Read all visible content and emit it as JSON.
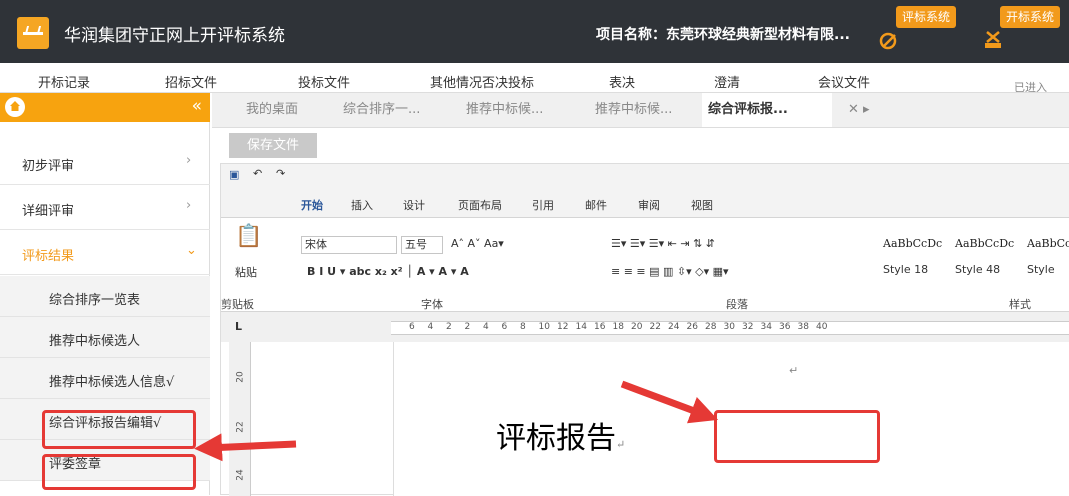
{
  "header": {
    "app_title": "华润集团守正网上开评标系统",
    "project_label": "项目名称：东莞环球经典新型材料有限...",
    "system_buttons": [
      "评标系统",
      "开标系统"
    ]
  },
  "menu": [
    "开标记录",
    "招标文件",
    "投标文件",
    "其他情况否决投标",
    "表决",
    "澄清",
    "会议文件",
    "已进入"
  ],
  "sidebar": {
    "collapse": "«",
    "items": [
      {
        "label": "初步评审",
        "chev": "›"
      },
      {
        "label": "详细评审",
        "chev": "›"
      },
      {
        "label": "评标结果",
        "chev": "⌄"
      }
    ],
    "subitems": [
      "综合排序一览表",
      "推荐中标候选人",
      "推荐中标候选人信息√",
      "综合评标报告编辑√",
      "评委签章"
    ]
  },
  "tabs": [
    "我的桌面",
    "综合排序一...",
    "推荐中标候...",
    "推荐中标候...",
    "综合评标报...",
    "✕ ▸"
  ],
  "save_button": "保存文件",
  "word": {
    "ribbon_tabs": [
      "开始",
      "插入",
      "设计",
      "页面布局",
      "引用",
      "邮件",
      "审阅",
      "视图"
    ],
    "font_name": "宋体",
    "font_size": "五号",
    "paste": "粘贴",
    "groups": [
      "剪贴板",
      "字体",
      "段落",
      "样式"
    ],
    "styles": [
      {
        "preview": "AaBbCcDc",
        "name": "Style 18"
      },
      {
        "preview": "AaBbCcDc",
        "name": "Style 48"
      },
      {
        "preview": "AaBbCc",
        "name": "Style"
      }
    ],
    "ruler_numbers": [
      "6",
      "4",
      "2",
      "2",
      "4",
      "6",
      "8",
      "10",
      "12",
      "14",
      "16",
      "18",
      "20",
      "22",
      "24",
      "26",
      "28",
      "30",
      "32",
      "34",
      "36",
      "38",
      "40"
    ],
    "vruler_numbers": [
      "20",
      "22",
      "24"
    ],
    "heading": "评标报告"
  },
  "colors": {
    "accent": "#f7a30f",
    "topbar": "#2f3338",
    "highlight": "#e53935"
  }
}
